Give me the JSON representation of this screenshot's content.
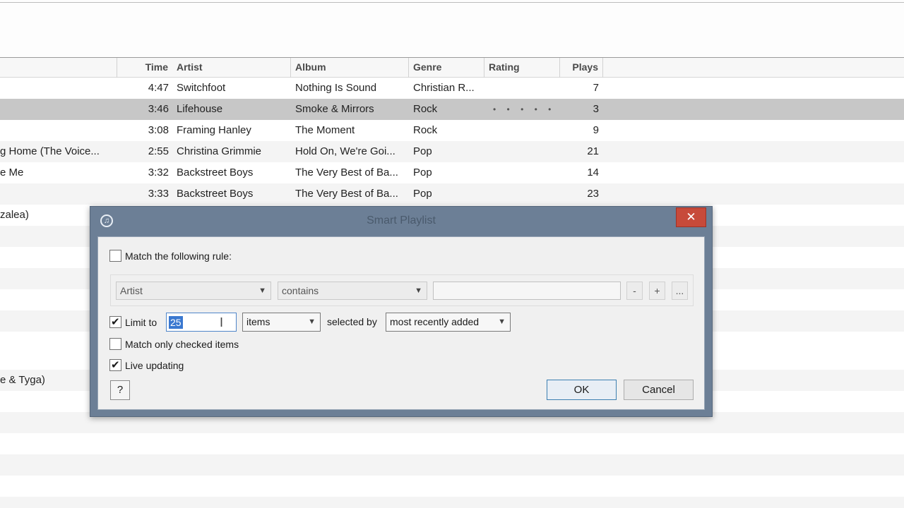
{
  "columns": {
    "time": "Time",
    "artist": "Artist",
    "album": "Album",
    "genre": "Genre",
    "rating": "Rating",
    "plays": "Plays"
  },
  "tracks": [
    {
      "name": "",
      "time": "4:47",
      "artist": "Switchfoot",
      "album": "Nothing Is Sound",
      "genre": "Christian R...",
      "rating": "",
      "plays": "7"
    },
    {
      "name": "",
      "time": "3:46",
      "artist": "Lifehouse",
      "album": "Smoke & Mirrors",
      "genre": "Rock",
      "rating": "• • • • • •",
      "plays": "3"
    },
    {
      "name": "",
      "time": "3:08",
      "artist": "Framing Hanley",
      "album": "The Moment",
      "genre": "Rock",
      "rating": "",
      "plays": "9"
    },
    {
      "name": "g Home (The Voice...",
      "time": "2:55",
      "artist": "Christina Grimmie",
      "album": "Hold On, We're Goi...",
      "genre": "Pop",
      "rating": "",
      "plays": "21"
    },
    {
      "name": "e Me",
      "time": "3:32",
      "artist": "Backstreet Boys",
      "album": "The Very Best of Ba...",
      "genre": "Pop",
      "rating": "",
      "plays": "14"
    },
    {
      "name": "",
      "time": "3:33",
      "artist": "Backstreet Boys",
      "album": "The Very Best of Ba...",
      "genre": "Pop",
      "rating": "",
      "plays": "23"
    },
    {
      "name": "zalea)"
    },
    {
      "name": ""
    },
    {
      "name": ""
    },
    {
      "name": ""
    },
    {
      "name": ""
    },
    {
      "name": ""
    },
    {
      "name": ""
    },
    {
      "name": "e & Tyga)"
    },
    {
      "name": ""
    },
    {
      "name": ""
    },
    {
      "name": ""
    },
    {
      "name": ""
    },
    {
      "name": ""
    },
    {
      "name": ""
    }
  ],
  "dialog": {
    "title": "Smart Playlist",
    "close_label": "✕",
    "match_rule_label": "Match the following rule:",
    "match_rule_checked": false,
    "rule_field": "Artist",
    "rule_operator": "contains",
    "rule_value": "",
    "minus_label": "-",
    "plus_label": "+",
    "more_label": "...",
    "limit_label": "Limit to",
    "limit_checked": true,
    "limit_value": "25",
    "limit_unit": "items",
    "selected_by_label": "selected by",
    "selected_by_value": "most recently added",
    "match_checked_label": "Match only checked items",
    "match_checked_checked": false,
    "live_updating_label": "Live updating",
    "live_updating_checked": true,
    "help_label": "?",
    "ok_label": "OK",
    "cancel_label": "Cancel"
  }
}
